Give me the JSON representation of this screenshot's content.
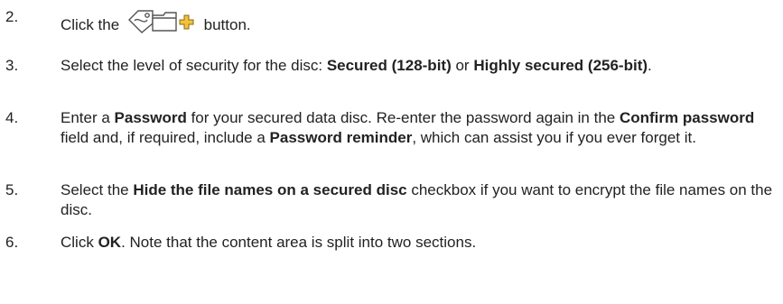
{
  "steps": [
    {
      "number": "2.",
      "parts": [
        {
          "text": "Click the ",
          "bold": false
        },
        {
          "icon": "add-secured-disc-icon"
        },
        {
          "text": " button.",
          "bold": false
        }
      ]
    },
    {
      "number": "3.",
      "parts": [
        {
          "text": "Select the level of security for the disc: ",
          "bold": false
        },
        {
          "text": "Secured (128-bit)",
          "bold": true
        },
        {
          "text": " or ",
          "bold": false
        },
        {
          "text": "Highly secured (256-bit)",
          "bold": true
        },
        {
          "text": ".",
          "bold": false
        }
      ]
    },
    {
      "number": "4.",
      "parts": [
        {
          "text": "Enter a ",
          "bold": false
        },
        {
          "text": "Password",
          "bold": true
        },
        {
          "text": " for your secured data disc. Re-enter the password again in the ",
          "bold": false
        },
        {
          "text": "Confirm password",
          "bold": true
        },
        {
          "text": " field and, if required, include a ",
          "bold": false
        },
        {
          "text": "Password reminder",
          "bold": true
        },
        {
          "text": ", which can assist you if you ever forget it.",
          "bold": false
        }
      ]
    },
    {
      "number": "5.",
      "parts": [
        {
          "text": "Select the ",
          "bold": false
        },
        {
          "text": "Hide the file names on a secured disc",
          "bold": true
        },
        {
          "text": " checkbox if you want to encrypt the file names on the disc.",
          "bold": false
        }
      ]
    },
    {
      "number": "6.",
      "parts": [
        {
          "text": "Click ",
          "bold": false
        },
        {
          "text": "OK",
          "bold": true
        },
        {
          "text": ". Note that the content area is split into two sections.",
          "bold": false
        }
      ]
    }
  ],
  "colors": {
    "text": "#222222",
    "icon_stroke": "#555555",
    "icon_plus_fill": "#f2c23a",
    "icon_plus_stroke": "#8a6a10"
  }
}
